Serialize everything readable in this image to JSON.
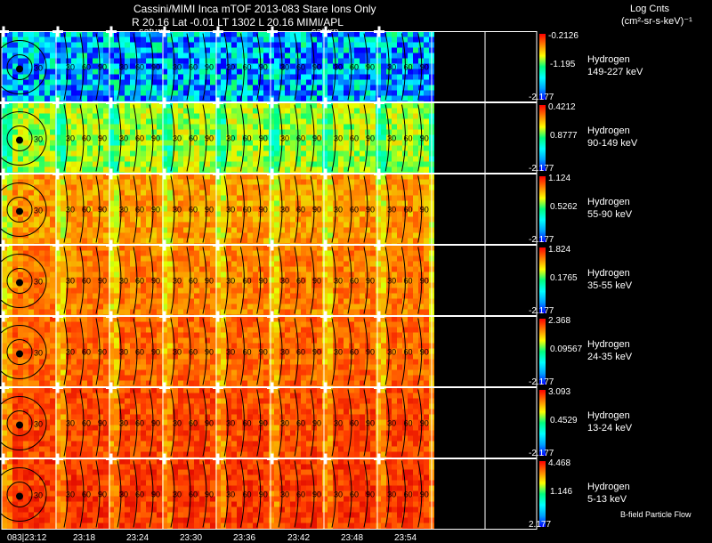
{
  "header": {
    "line1": "Cassini/MIMI Inca mTOF  2013-083   Stare   Ions Only",
    "line2": "R        20.16 Lat -0.01 LT 1302 L        20.16  MIMI/APL",
    "saturn_labels": [
      "saturn",
      "saturn"
    ]
  },
  "units": {
    "line1": "Log Cnts",
    "line2": "(cm²-sr-s-keV)⁻¹"
  },
  "panels": [
    {
      "species": "Hydrogen",
      "energy": "149-227 keV",
      "cmax": "-0.2126",
      "cmid": "-1.195",
      "cmin": "-2.177",
      "level": 0.22
    },
    {
      "species": "Hydrogen",
      "energy": "90-149 keV",
      "cmax": "0.4212",
      "cmid": "0.8777",
      "cmin": "-2.177",
      "level": 0.55
    },
    {
      "species": "Hydrogen",
      "energy": "55-90 keV",
      "cmax": "1.124",
      "cmid": "0.5262",
      "cmin": "-2.177",
      "level": 0.72
    },
    {
      "species": "Hydrogen",
      "energy": "35-55 keV",
      "cmax": "1.824",
      "cmid": "0.1765",
      "cmin": "-2.177",
      "level": 0.76
    },
    {
      "species": "Hydrogen",
      "energy": "24-35 keV",
      "cmax": "2.368",
      "cmid": "0.09567",
      "cmin": "-2.177",
      "level": 0.8
    },
    {
      "species": "Hydrogen",
      "energy": "13-24 keV",
      "cmax": "3.093",
      "cmid": "0.4529",
      "cmin": "-2.177",
      "level": 0.85
    },
    {
      "species": "Hydrogen",
      "energy": "5-13 keV",
      "cmax": "4.468",
      "cmid": "1.146",
      "cmin": "2.177",
      "level": 0.88
    }
  ],
  "chart_data": {
    "type": "heatmap",
    "title": "Cassini/MIMI Inca mTOF  2013-083   Stare   Ions Only",
    "colorbar_label": "Log Cnts (cm²-sr-s-keV)⁻¹",
    "x_tick_labels": [
      "083|23:12",
      "23:18",
      "23:24",
      "23:30",
      "23:36",
      "23:42",
      "23:48",
      "23:54"
    ],
    "contour_labels": [
      "30",
      "60",
      "90"
    ],
    "series": [
      {
        "name": "Hydrogen 149-227 keV",
        "range": [
          -2.177,
          -0.2126
        ]
      },
      {
        "name": "Hydrogen 90-149 keV",
        "range": [
          -2.177,
          0.4212
        ]
      },
      {
        "name": "Hydrogen 55-90 keV",
        "range": [
          -2.177,
          1.124
        ]
      },
      {
        "name": "Hydrogen 35-55 keV",
        "range": [
          -2.177,
          1.824
        ]
      },
      {
        "name": "Hydrogen 24-35 keV",
        "range": [
          -2.177,
          2.368
        ]
      },
      {
        "name": "Hydrogen 13-24 keV",
        "range": [
          -2.177,
          3.093
        ]
      },
      {
        "name": "Hydrogen 5-13 keV",
        "range": [
          2.177,
          4.468
        ]
      }
    ]
  },
  "legend_note": "B-field Particle Flow"
}
